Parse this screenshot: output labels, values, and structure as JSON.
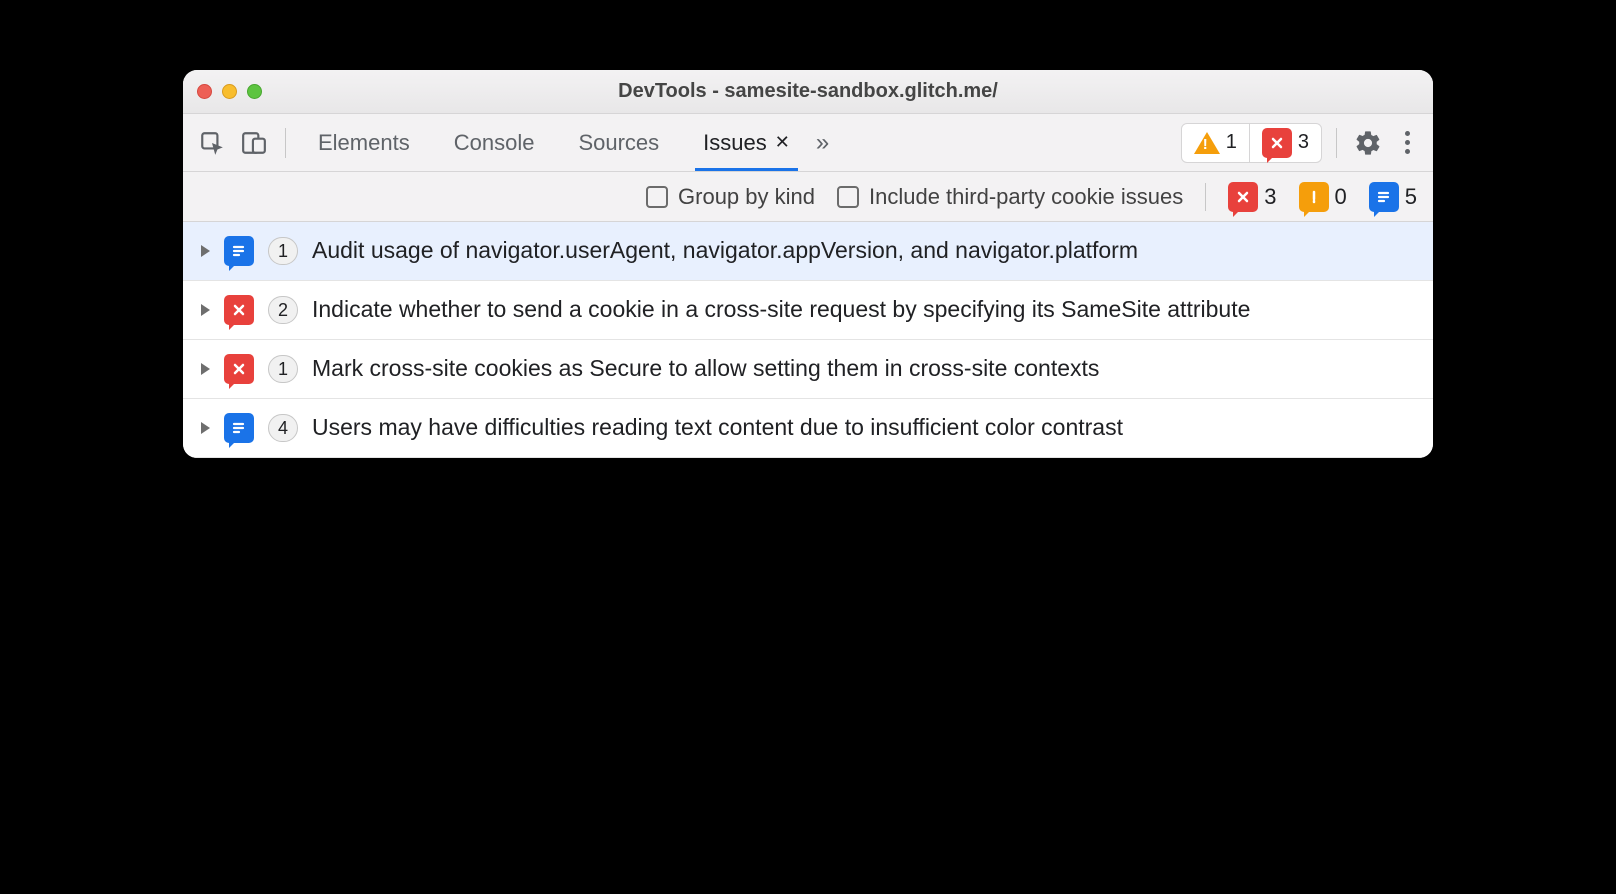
{
  "window": {
    "title": "DevTools - samesite-sandbox.glitch.me/"
  },
  "tabs": {
    "elements": "Elements",
    "console": "Console",
    "sources": "Sources",
    "issues": "Issues"
  },
  "toolbar_counts": {
    "warnings": "1",
    "errors": "3"
  },
  "filters": {
    "group_by_kind": "Group by kind",
    "include_third_party": "Include third-party cookie issues",
    "counts": {
      "errors": "3",
      "warnings": "0",
      "info": "5"
    }
  },
  "issues": [
    {
      "kind": "info",
      "count": "1",
      "text": "Audit usage of navigator.userAgent, navigator.appVersion, and navigator.platform"
    },
    {
      "kind": "error",
      "count": "2",
      "text": "Indicate whether to send a cookie in a cross-site request by specifying its SameSite attribute"
    },
    {
      "kind": "error",
      "count": "1",
      "text": "Mark cross-site cookies as Secure to allow setting them in cross-site contexts"
    },
    {
      "kind": "info",
      "count": "4",
      "text": "Users may have difficulties reading text content due to insufficient color contrast"
    }
  ]
}
